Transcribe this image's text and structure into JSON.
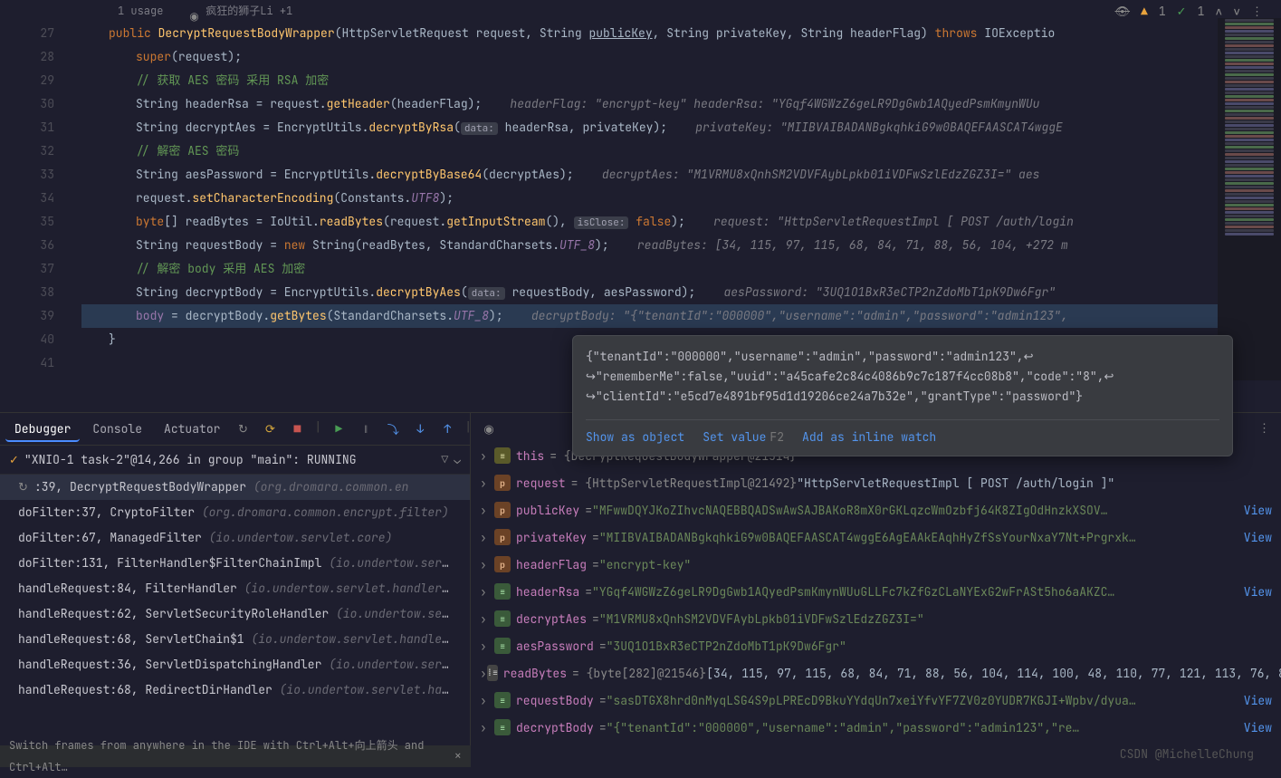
{
  "meta": {
    "usages": "1 usage",
    "author": "疯狂的狮子Li +1"
  },
  "topbar": {
    "warn_count": "1",
    "ok_count": "1",
    "nav": "∧ ∨"
  },
  "gutter": {
    "start": 27,
    "end": 41
  },
  "code": {
    "l27": "public DecryptRequestBodyWrapper(HttpServletRequest request, String publicKey, String privateKey, String headerFlag) throws IOExceptio",
    "l28_super": "super",
    "l28_rest": "(request);",
    "l29": "// 获取 AES 密码 采用 RSA 加密",
    "l30_a": "String headerRsa = request.",
    "l30_m": "getHeader",
    "l30_b": "(headerFlag);",
    "l30_hint": "headerFlag: \"encrypt-key\"        headerRsa: \"YGqf4WGWzZ6geLR9DgGwb1AQyedPsmKmynWUu",
    "l31_a": "String decryptAes = EncryptUtils.",
    "l31_m": "decryptByRsa",
    "l31_b": "(",
    "l31_tag": "data:",
    "l31_c": "headerRsa, privateKey);",
    "l31_hint": "privateKey: \"MIIBVAIBADANBgkqhkiG9w0BAQEFAASCAT4wggE",
    "l32": "// 解密 AES 密码",
    "l33_a": "String aesPassword = EncryptUtils.",
    "l33_m": "decryptByBase64",
    "l33_b": "(decryptAes);",
    "l33_hint": "decryptAes: \"M1VRMU8xQnhSM2VDVFAybLpkb01iVDFwSzlEdzZGZ3I=\"      aes",
    "l34_a": "request.",
    "l34_m": "setCharacterEncoding",
    "l34_b": "(Constants.",
    "l34_c": "UTF8",
    "l34_d": ");",
    "l35_a": "byte[] readBytes = IoUtil.",
    "l35_m": "readBytes",
    "l35_b": "(request.",
    "l35_m2": "getInputStream",
    "l35_c": "(), ",
    "l35_tag": "isClose:",
    "l35_d": "false);",
    "l35_hint": "request: \"HttpServletRequestImpl [ POST /auth/login",
    "l36_a": "String requestBody = ",
    "l36_new": "new ",
    "l36_b": "String(readBytes, StandardCharsets.",
    "l36_c": "UTF_8",
    "l36_d": ");",
    "l36_hint": "readBytes: [34, 115, 97, 115, 68, 84, 71, 88, 56, 104, +272 m",
    "l37": "// 解密 body 采用 AES 加密",
    "l38_a": "String decryptBody = EncryptUtils.",
    "l38_m": "decryptByAes",
    "l38_b": "(",
    "l38_tag": "data:",
    "l38_c": "requestBody, aesPassword);",
    "l38_hint": "aesPassword: \"3UQ1O1BxR3eCTP2nZdoMbT1pK9Dw6Fgr\"",
    "l39_a": "body",
    "l39_b": " = decryptBody.",
    "l39_m": "getBytes",
    "l39_c": "(StandardCharsets.",
    "l39_d": "UTF_8",
    "l39_e": ");",
    "l39_hint": "decryptBody: \"{\"tenantId\":\"000000\",\"username\":\"admin\",\"password\":\"admin123\",",
    "l40": "}"
  },
  "tooltip": {
    "body": "{\"tenantId\":\"000000\",\"username\":\"admin\",\"password\":\"admin123\",↩\n↪\"rememberMe\":false,\"uuid\":\"a45cafe2c84c4086b9c7c187f4cc08b8\",\"code\":\"8\",↩\n↪\"clientId\":\"e5cd7e4891bf95d1d19206ce24a7b32e\",\"grantType\":\"password\"}",
    "action_show": "Show as object",
    "action_set": "Set value",
    "shortcut": "F2",
    "action_watch": "Add as inline watch"
  },
  "debug": {
    "tab_debugger": "Debugger",
    "tab_console": "Console",
    "tab_actuator": "Actuator",
    "thread_status": "\"XNIO-1 task-2\"@14,266 in group \"main\": RUNNING",
    "frames": [
      {
        "main": "<init>:39, DecryptRequestBodyWrapper ",
        "pkg": "(org.dromara.common.en",
        "sel": true,
        "restart": true
      },
      {
        "main": "doFilter:37, CryptoFilter ",
        "pkg": "(org.dromara.common.encrypt.filter)"
      },
      {
        "main": "doFilter:67, ManagedFilter ",
        "pkg": "(io.undertow.servlet.core)"
      },
      {
        "main": "doFilter:131, FilterHandler$FilterChainImpl ",
        "pkg": "(io.undertow.servlet.han"
      },
      {
        "main": "handleRequest:84, FilterHandler ",
        "pkg": "(io.undertow.servlet.handlers)"
      },
      {
        "main": "handleRequest:62, ServletSecurityRoleHandler ",
        "pkg": "(io.undertow.servle"
      },
      {
        "main": "handleRequest:68, ServletChain$1 ",
        "pkg": "(io.undertow.servlet.handlers)"
      },
      {
        "main": "handleRequest:36, ServletDispatchingHandler ",
        "pkg": "(io.undertow.servlet."
      },
      {
        "main": "handleRequest:68, RedirectDirHandler ",
        "pkg": "(io.undertow.servlet.handler"
      }
    ],
    "vars": [
      {
        "ico": "this",
        "name": "this",
        "val": " = {DecryptRequestBodyWrapper@21514}",
        "type": "grey"
      },
      {
        "ico": "p",
        "name": "request",
        "val_grey": " = {HttpServletRequestImpl@21492} ",
        "val_plain": "\"HttpServletRequestImpl [ POST /auth/login ]\""
      },
      {
        "ico": "p",
        "name": "publicKey",
        "val_eq": " = ",
        "val_str": "\"MFwwDQYJKoZIhvcNAQEBBQADSwAwSAJBAKoR8mX0rGKLqzcWmOzbfj64K8ZIgOdHnzkXSOV…",
        "link": "View"
      },
      {
        "ico": "p",
        "name": "privateKey",
        "val_eq": " = ",
        "val_str": "\"MIIBVAIBADANBgkqhkiG9w0BAQEFAASCAT4wggE6AgEAAkEAqhHyZfSsYourNxaY7Nt+Prgrxk…",
        "link": "View"
      },
      {
        "ico": "p",
        "name": "headerFlag",
        "val_eq": " = ",
        "val_str": "\"encrypt-key\""
      },
      {
        "ico": "obj",
        "name": "headerRsa",
        "val_eq": " = ",
        "val_str": "\"YGqf4WGWzZ6geLR9DgGwb1AQyedPsmKmynWUuGLLFc7kZfGzCLaNYExG2wFrASt5ho6aAKZC…",
        "link": "View"
      },
      {
        "ico": "obj",
        "name": "decryptAes",
        "val_eq": " = ",
        "val_str": "\"M1VRMU8xQnhSM2VDVFAybLpkb01iVDFwSzlEdzZGZ3I=\""
      },
      {
        "ico": "obj",
        "name": "aesPassword",
        "val_eq": " = ",
        "val_str": "\"3UQ1O1BxR3eCTP2nZdoMbT1pK9Dw6Fgr\""
      },
      {
        "ico": "arr",
        "name": "readBytes",
        "val_grey": " = {byte[282]@21546} ",
        "val_plain": "[34, 115, 97, 115, 68, 84, 71, 88, 56, 104, 114, 100, 48, 110, 77, 121, 113, 76, 8…",
        "link": "View"
      },
      {
        "ico": "obj",
        "name": "requestBody",
        "val_eq": " = ",
        "val_str": "\"sasDTGX8hrd0nMyqLSG4S9pLPREcD9BkuYYdqUn7xeiYfvYF7ZV0z0YUDR7KGJI+Wpbv/dyua…",
        "link": "View"
      },
      {
        "ico": "obj",
        "name": "decryptBody",
        "val_eq": " = ",
        "val_str": "\"{\"tenantId\":\"000000\",\"username\":\"admin\",\"password\":\"admin123\",\"re…",
        "link": "View"
      }
    ]
  },
  "status": "Switch frames from anywhere in the IDE with Ctrl+Alt+向上箭头 and Ctrl+Alt…",
  "watermark": "CSDN @MichelleChung"
}
